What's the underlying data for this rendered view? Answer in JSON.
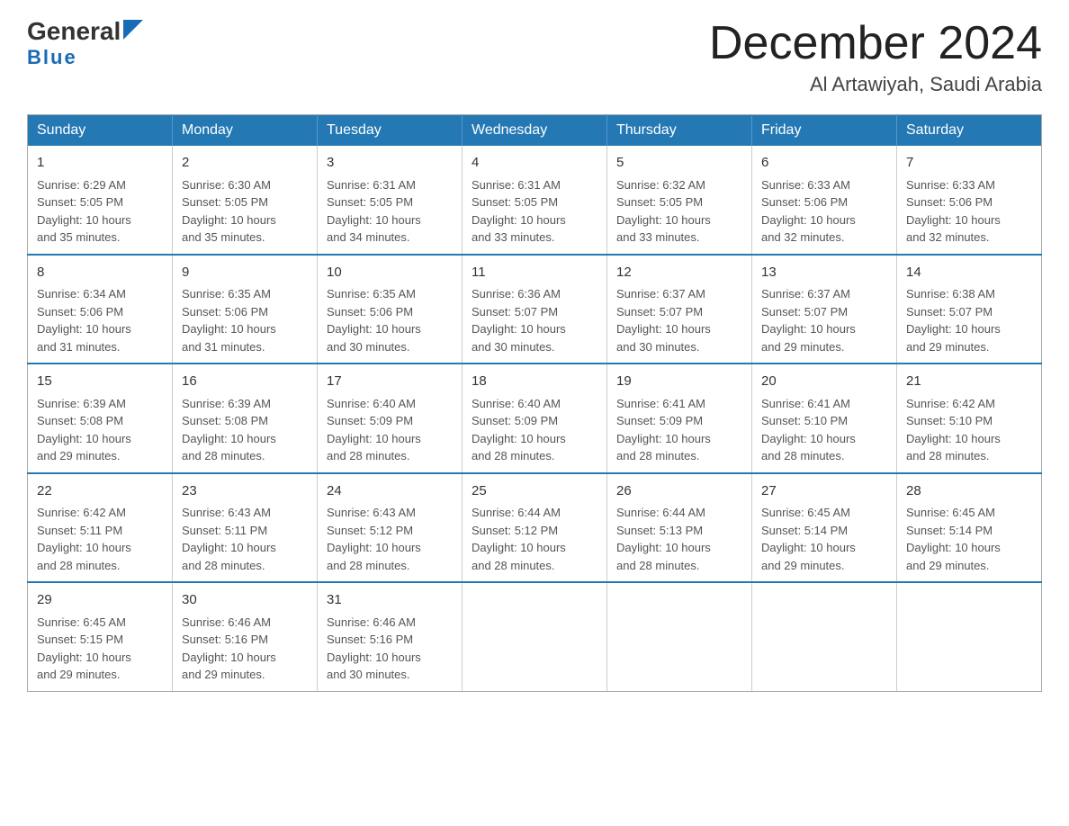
{
  "logo": {
    "general": "General",
    "blue": "Blue"
  },
  "header": {
    "month": "December 2024",
    "location": "Al Artawiyah, Saudi Arabia"
  },
  "weekdays": [
    "Sunday",
    "Monday",
    "Tuesday",
    "Wednesday",
    "Thursday",
    "Friday",
    "Saturday"
  ],
  "weeks": [
    [
      {
        "day": "1",
        "sunrise": "6:29 AM",
        "sunset": "5:05 PM",
        "daylight": "10 hours and 35 minutes."
      },
      {
        "day": "2",
        "sunrise": "6:30 AM",
        "sunset": "5:05 PM",
        "daylight": "10 hours and 35 minutes."
      },
      {
        "day": "3",
        "sunrise": "6:31 AM",
        "sunset": "5:05 PM",
        "daylight": "10 hours and 34 minutes."
      },
      {
        "day": "4",
        "sunrise": "6:31 AM",
        "sunset": "5:05 PM",
        "daylight": "10 hours and 33 minutes."
      },
      {
        "day": "5",
        "sunrise": "6:32 AM",
        "sunset": "5:05 PM",
        "daylight": "10 hours and 33 minutes."
      },
      {
        "day": "6",
        "sunrise": "6:33 AM",
        "sunset": "5:06 PM",
        "daylight": "10 hours and 32 minutes."
      },
      {
        "day": "7",
        "sunrise": "6:33 AM",
        "sunset": "5:06 PM",
        "daylight": "10 hours and 32 minutes."
      }
    ],
    [
      {
        "day": "8",
        "sunrise": "6:34 AM",
        "sunset": "5:06 PM",
        "daylight": "10 hours and 31 minutes."
      },
      {
        "day": "9",
        "sunrise": "6:35 AM",
        "sunset": "5:06 PM",
        "daylight": "10 hours and 31 minutes."
      },
      {
        "day": "10",
        "sunrise": "6:35 AM",
        "sunset": "5:06 PM",
        "daylight": "10 hours and 30 minutes."
      },
      {
        "day": "11",
        "sunrise": "6:36 AM",
        "sunset": "5:07 PM",
        "daylight": "10 hours and 30 minutes."
      },
      {
        "day": "12",
        "sunrise": "6:37 AM",
        "sunset": "5:07 PM",
        "daylight": "10 hours and 30 minutes."
      },
      {
        "day": "13",
        "sunrise": "6:37 AM",
        "sunset": "5:07 PM",
        "daylight": "10 hours and 29 minutes."
      },
      {
        "day": "14",
        "sunrise": "6:38 AM",
        "sunset": "5:07 PM",
        "daylight": "10 hours and 29 minutes."
      }
    ],
    [
      {
        "day": "15",
        "sunrise": "6:39 AM",
        "sunset": "5:08 PM",
        "daylight": "10 hours and 29 minutes."
      },
      {
        "day": "16",
        "sunrise": "6:39 AM",
        "sunset": "5:08 PM",
        "daylight": "10 hours and 28 minutes."
      },
      {
        "day": "17",
        "sunrise": "6:40 AM",
        "sunset": "5:09 PM",
        "daylight": "10 hours and 28 minutes."
      },
      {
        "day": "18",
        "sunrise": "6:40 AM",
        "sunset": "5:09 PM",
        "daylight": "10 hours and 28 minutes."
      },
      {
        "day": "19",
        "sunrise": "6:41 AM",
        "sunset": "5:09 PM",
        "daylight": "10 hours and 28 minutes."
      },
      {
        "day": "20",
        "sunrise": "6:41 AM",
        "sunset": "5:10 PM",
        "daylight": "10 hours and 28 minutes."
      },
      {
        "day": "21",
        "sunrise": "6:42 AM",
        "sunset": "5:10 PM",
        "daylight": "10 hours and 28 minutes."
      }
    ],
    [
      {
        "day": "22",
        "sunrise": "6:42 AM",
        "sunset": "5:11 PM",
        "daylight": "10 hours and 28 minutes."
      },
      {
        "day": "23",
        "sunrise": "6:43 AM",
        "sunset": "5:11 PM",
        "daylight": "10 hours and 28 minutes."
      },
      {
        "day": "24",
        "sunrise": "6:43 AM",
        "sunset": "5:12 PM",
        "daylight": "10 hours and 28 minutes."
      },
      {
        "day": "25",
        "sunrise": "6:44 AM",
        "sunset": "5:12 PM",
        "daylight": "10 hours and 28 minutes."
      },
      {
        "day": "26",
        "sunrise": "6:44 AM",
        "sunset": "5:13 PM",
        "daylight": "10 hours and 28 minutes."
      },
      {
        "day": "27",
        "sunrise": "6:45 AM",
        "sunset": "5:14 PM",
        "daylight": "10 hours and 29 minutes."
      },
      {
        "day": "28",
        "sunrise": "6:45 AM",
        "sunset": "5:14 PM",
        "daylight": "10 hours and 29 minutes."
      }
    ],
    [
      {
        "day": "29",
        "sunrise": "6:45 AM",
        "sunset": "5:15 PM",
        "daylight": "10 hours and 29 minutes."
      },
      {
        "day": "30",
        "sunrise": "6:46 AM",
        "sunset": "5:16 PM",
        "daylight": "10 hours and 29 minutes."
      },
      {
        "day": "31",
        "sunrise": "6:46 AM",
        "sunset": "5:16 PM",
        "daylight": "10 hours and 30 minutes."
      },
      null,
      null,
      null,
      null
    ]
  ],
  "labels": {
    "sunrise": "Sunrise:",
    "sunset": "Sunset:",
    "daylight": "Daylight:"
  }
}
